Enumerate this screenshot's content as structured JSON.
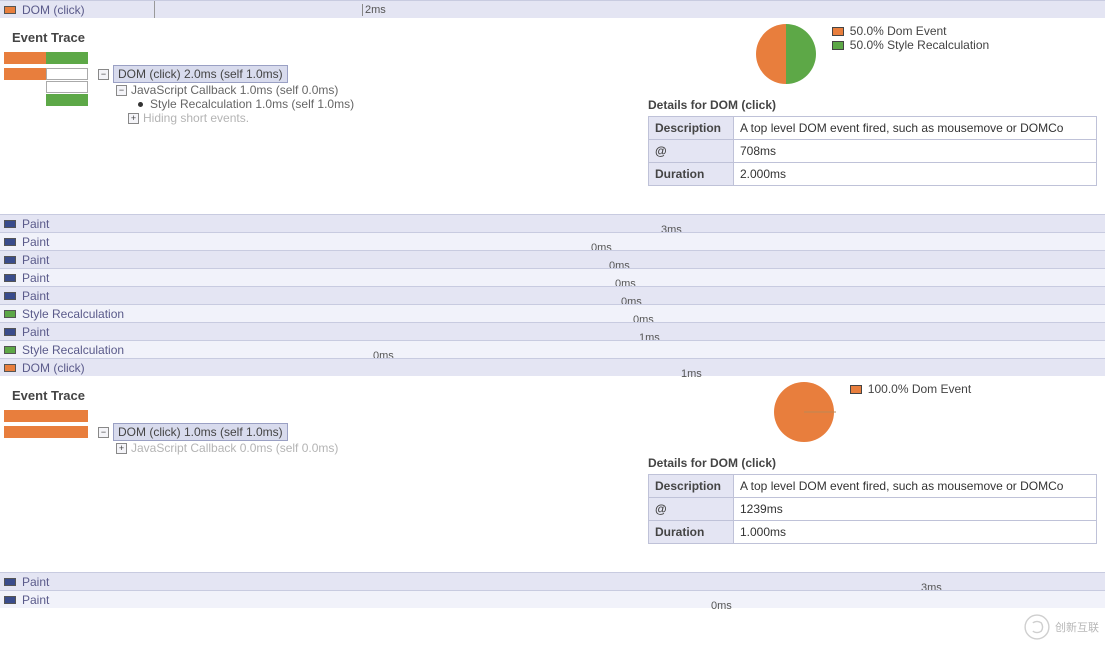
{
  "colors": {
    "orange": "#e87e3d",
    "green": "#5da847",
    "navy": "#3a4c8b"
  },
  "section1": {
    "header": {
      "swatch": "orange",
      "label": "DOM (click)",
      "time": "2ms"
    },
    "trace_title": "Event Trace",
    "tree": {
      "root": "DOM (click) 2.0ms (self 1.0ms)",
      "child1": "JavaScript Callback 1.0ms (self 0.0ms)",
      "child2": "Style Recalculation 1.0ms (self 1.0ms)",
      "note": "Hiding short events."
    },
    "legend": [
      {
        "color": "orange",
        "text": "50.0% Dom Event"
      },
      {
        "color": "green",
        "text": "50.0% Style Recalculation"
      }
    ],
    "chart_data": {
      "type": "pie",
      "title": "",
      "slices": [
        {
          "label": "Dom Event",
          "value": 50.0,
          "color": "#e87e3d"
        },
        {
          "label": "Style Recalculation",
          "value": 50.0,
          "color": "#5da847"
        }
      ]
    },
    "details_title": "Details for DOM (click)",
    "details": {
      "description_label": "Description",
      "description": "A top level DOM event fired, such as mousemove or DOMCo",
      "at_label": "@",
      "at": "708ms",
      "duration_label": "Duration",
      "duration": "2.000ms"
    }
  },
  "event_list": [
    {
      "swatch": "navy",
      "label": "Paint",
      "ms": "3ms",
      "msPos": 500
    },
    {
      "swatch": "navy",
      "label": "Paint",
      "ms": "0ms",
      "msPos": 430
    },
    {
      "swatch": "navy",
      "label": "Paint",
      "ms": "0ms",
      "msPos": 448
    },
    {
      "swatch": "navy",
      "label": "Paint",
      "ms": "0ms",
      "msPos": 454
    },
    {
      "swatch": "navy",
      "label": "Paint",
      "ms": "0ms",
      "msPos": 460
    },
    {
      "swatch": "green",
      "label": "Style Recalculation",
      "ms": "0ms",
      "msPos": 472
    },
    {
      "swatch": "navy",
      "label": "Paint",
      "ms": "1ms",
      "msPos": 478
    },
    {
      "swatch": "green",
      "label": "Style Recalculation",
      "ms": "0ms",
      "msPos": 212
    },
    {
      "swatch": "orange",
      "label": "DOM (click)",
      "ms": "1ms",
      "msPos": 520
    }
  ],
  "section2": {
    "trace_title": "Event Trace",
    "tree": {
      "root": "DOM (click) 1.0ms (self 1.0ms)",
      "child1": "JavaScript Callback 0.0ms (self 0.0ms)"
    },
    "legend": [
      {
        "color": "orange",
        "text": "100.0% Dom Event"
      }
    ],
    "chart_data": {
      "type": "pie",
      "title": "",
      "slices": [
        {
          "label": "Dom Event",
          "value": 100.0,
          "color": "#e87e3d"
        }
      ]
    },
    "details_title": "Details for DOM (click)",
    "details": {
      "description_label": "Description",
      "description": "A top level DOM event fired, such as mousemove or DOMCo",
      "at_label": "@",
      "at": "1239ms",
      "duration_label": "Duration",
      "duration": "1.000ms"
    }
  },
  "footer_rows": [
    {
      "swatch": "navy",
      "label": "Paint",
      "ms": "3ms",
      "msPos": 760
    },
    {
      "swatch": "navy",
      "label": "Paint",
      "ms": "0ms",
      "msPos": 550
    }
  ],
  "watermark": "创新互联"
}
